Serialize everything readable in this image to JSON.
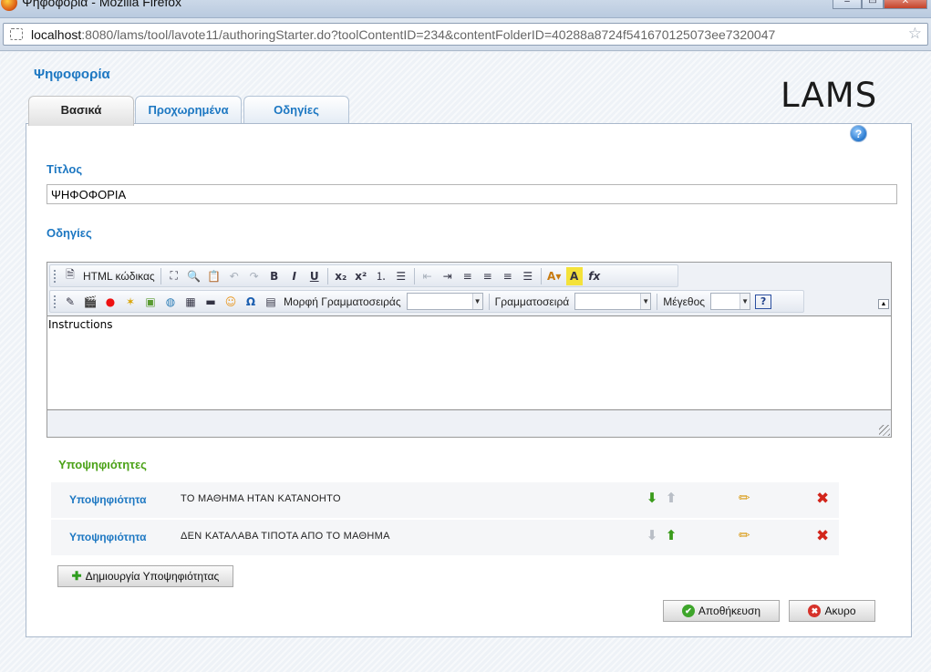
{
  "window": {
    "title": "Ψηφοφορία - Mozilla Firefox",
    "url_host": "localhost",
    "url_rest": ":8080/lams/tool/lavote11/authoringStarter.do?toolContentID=234&contentFolderID=40288a8724f541670125073ee7320047"
  },
  "page": {
    "title": "Ψηφοφορία",
    "logo": "LAMS"
  },
  "tabs": [
    {
      "label": "Βασικά",
      "active": true
    },
    {
      "label": "Προχωρημένα",
      "active": false
    },
    {
      "label": "Οδηγίες",
      "active": false
    }
  ],
  "form": {
    "title_label": "Τίτλος",
    "title_value": "ΨΗΦΟΦΟΡΙΑ",
    "instructions_label": "Οδηγίες",
    "instructions_value": "Instructions"
  },
  "editor_toolbar": {
    "html_source_label": "HTML κώδικας",
    "font_format_label": "Μορφή Γραμματοσειράς",
    "font_label": "Γραμματοσειρά",
    "size_label": "Μέγεθος"
  },
  "candidates": {
    "heading": "Υποψηφιότητες",
    "items": [
      {
        "label": "Υποψηφιότητα",
        "text": "ΤΟ ΜΑΘΗΜΑ ΗΤΑΝ ΚΑΤΑΝΟΗΤΟ"
      },
      {
        "label": "Υποψηφιότητα",
        "text": "ΔΕΝ ΚΑΤΑΛΑΒΑ ΤΙΠΟΤΑ ΑΠΟ ΤΟ ΜΑΘΗΜΑ"
      }
    ],
    "add_button": "Δημιουργία Υποψηφιότητας"
  },
  "actions": {
    "save": "Αποθήκευση",
    "cancel": "Ακυρο"
  },
  "colors": {
    "link_blue": "#1c77c2",
    "heading_green": "#4ba217",
    "delete_red": "#d2251b"
  }
}
